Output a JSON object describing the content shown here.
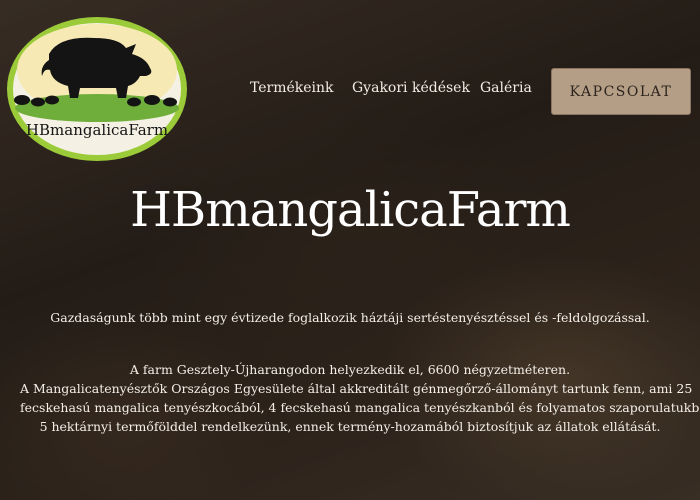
{
  "logo": {
    "text": "HBmangalicaFarm",
    "icon": "pig-icon"
  },
  "nav": {
    "items": [
      {
        "label": "Termékeink"
      },
      {
        "label": "Gyakori kédések"
      },
      {
        "label": "Galéria"
      }
    ],
    "contact_label": "KAPCSOLAT"
  },
  "hero": {
    "title": "HBmangalicaFarm",
    "intro": "Gazdaságunk több mint egy évtizede foglalkozik háztáji sertéstenyésztéssel és -feldolgozással.",
    "info_lines": [
      "A farm Gesztely-Újharangodon helyezkedik el, 6600 négyzetméteren.",
      "A Mangalicatenyésztők Országos Egyesülete által akkreditált génmegőrző-állományt tartunk fenn, ami 25",
      "fecskehasú mangalica tenyészkocából, 4 fecskehasú mangalica tenyészkanból és folyamatos szaporulatukból áll.",
      "5 hektárnyi termőfölddel rendelkezünk, ennek termény-hozamából biztosítjuk az állatok ellátását."
    ]
  },
  "colors": {
    "button_bg": "#b59e86",
    "logo_ring": "#9ccb3a"
  }
}
